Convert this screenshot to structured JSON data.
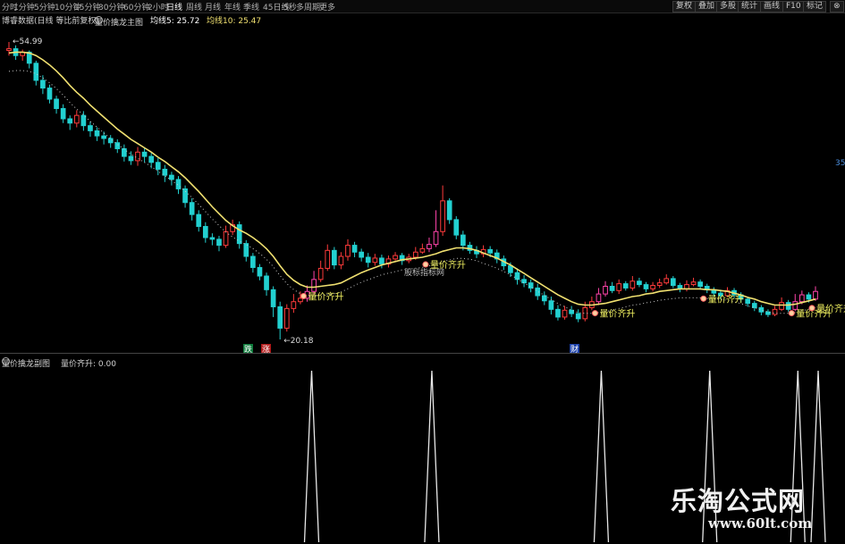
{
  "toolbar": {
    "periods": [
      "分时",
      "1分钟",
      "5分钟",
      "10分钟",
      "15分钟",
      "30分钟",
      "60分钟",
      "2小时",
      "日线",
      "周线",
      "月线",
      "年线",
      "季线",
      "45日线",
      "5秒",
      "多周期",
      "更多"
    ],
    "active_period": "日线",
    "right_buttons": [
      "复权",
      "叠加",
      "多股",
      "统计",
      "画线",
      "F10",
      "标记"
    ]
  },
  "header": {
    "source": "博睿数据(日线 等比前复权)",
    "main_indicator": "量价擒龙主图",
    "ma5": "均线5: 25.72",
    "ma10": "均线10: 25.47"
  },
  "sub_header": {
    "indicator": "量价擒龙副图",
    "value": "量价齐升: 0.00"
  },
  "annotations": {
    "high_price": "54.99",
    "low_price": "20.18",
    "center_watermark": "股标指标网",
    "signal_label": "量价齐升",
    "label_die": "跌",
    "label_zhang": "涨",
    "label_cai": "财",
    "right_edge": "35"
  },
  "watermark": {
    "title": "乐淘公式网",
    "url": "www.60lt.com"
  },
  "colors": {
    "up": "#ff3b3b",
    "down": "#22d0d0",
    "up_strong": "#ff44aa",
    "ma": "#f0e070",
    "dotted": "#cccccc",
    "signal_text": "#f0f060",
    "sub_line": "#e8e8e8"
  },
  "chart_data": {
    "type": "candlestick",
    "ylim": [
      20.18,
      54.99
    ],
    "candles": [
      [
        54.0,
        54.2,
        54.99,
        53.4
      ],
      [
        54.2,
        53.4,
        54.6,
        52.9
      ],
      [
        53.4,
        53.8,
        54.1,
        52.8
      ],
      [
        53.8,
        52.5,
        54.0,
        51.9
      ],
      [
        52.5,
        50.5,
        52.8,
        49.9
      ],
      [
        50.5,
        49.6,
        51.1,
        48.9
      ],
      [
        49.6,
        48.3,
        50.0,
        47.8
      ],
      [
        48.3,
        47.2,
        48.7,
        46.6
      ],
      [
        47.2,
        46.0,
        47.7,
        45.5
      ],
      [
        46.0,
        45.5,
        46.4,
        44.7
      ],
      [
        45.5,
        46.4,
        47.0,
        45.0
      ],
      [
        46.4,
        45.2,
        46.9,
        44.6
      ],
      [
        45.2,
        44.6,
        45.7,
        43.9
      ],
      [
        44.6,
        44.0,
        45.0,
        43.4
      ],
      [
        44.0,
        43.7,
        44.5,
        43.0
      ],
      [
        43.7,
        43.2,
        44.1,
        42.6
      ],
      [
        43.2,
        42.5,
        43.6,
        42.0
      ],
      [
        42.5,
        41.6,
        43.0,
        41.0
      ],
      [
        41.6,
        41.1,
        42.2,
        40.6
      ],
      [
        41.1,
        42.1,
        42.7,
        40.5
      ],
      [
        42.1,
        41.6,
        42.6,
        40.9
      ],
      [
        41.6,
        40.9,
        42.0,
        40.2
      ],
      [
        40.9,
        40.1,
        41.4,
        39.4
      ],
      [
        40.1,
        39.4,
        40.6,
        38.6
      ],
      [
        39.4,
        38.9,
        39.8,
        38.2
      ],
      [
        38.9,
        37.8,
        39.3,
        37.2
      ],
      [
        37.8,
        36.2,
        38.2,
        35.6
      ],
      [
        36.2,
        34.8,
        36.7,
        34.1
      ],
      [
        34.8,
        33.4,
        35.3,
        32.8
      ],
      [
        33.4,
        32.1,
        33.9,
        31.5
      ],
      [
        32.1,
        31.9,
        32.6,
        31.2
      ],
      [
        31.9,
        31.2,
        32.3,
        30.5
      ],
      [
        31.2,
        32.8,
        33.5,
        30.9
      ],
      [
        32.8,
        33.6,
        34.2,
        32.4
      ],
      [
        33.6,
        31.4,
        34.0,
        30.8
      ],
      [
        31.4,
        29.9,
        31.8,
        29.3
      ],
      [
        29.9,
        28.6,
        30.3,
        28.0
      ],
      [
        28.6,
        27.6,
        29.0,
        27.1
      ],
      [
        27.6,
        26.0,
        28.0,
        25.3
      ],
      [
        26.0,
        24.0,
        26.4,
        22.8
      ],
      [
        24.0,
        21.5,
        24.6,
        20.18
      ],
      [
        21.5,
        23.8,
        24.3,
        21.1
      ],
      [
        23.8,
        24.6,
        25.5,
        23.3
      ],
      [
        24.6,
        25.0,
        25.8,
        24.3
      ],
      [
        25.0,
        25.8,
        26.5,
        24.6
      ],
      [
        25.8,
        27.2,
        28.2,
        25.4
      ],
      [
        27.2,
        28.5,
        29.4,
        26.9
      ],
      [
        28.5,
        30.6,
        31.3,
        28.2
      ],
      [
        30.6,
        28.9,
        31.0,
        28.4
      ],
      [
        28.9,
        29.9,
        30.4,
        28.4
      ],
      [
        29.9,
        31.2,
        31.9,
        29.4
      ],
      [
        31.2,
        30.4,
        31.6,
        29.8
      ],
      [
        30.4,
        29.8,
        30.8,
        29.3
      ],
      [
        29.8,
        29.2,
        30.3,
        28.6
      ],
      [
        29.2,
        29.7,
        30.2,
        28.8
      ],
      [
        29.7,
        29.0,
        30.1,
        28.5
      ],
      [
        29.0,
        29.6,
        30.0,
        28.6
      ],
      [
        29.6,
        30.0,
        30.4,
        29.4
      ],
      [
        30.0,
        29.4,
        30.3,
        28.9
      ],
      [
        29.4,
        29.8,
        30.2,
        29.1
      ],
      [
        29.8,
        30.4,
        31.0,
        29.5
      ],
      [
        30.4,
        30.8,
        31.4,
        30.2
      ],
      [
        30.8,
        31.3,
        32.1,
        30.4
      ],
      [
        31.3,
        32.8,
        35.3,
        31.0
      ],
      [
        32.8,
        36.4,
        38.2,
        32.3
      ],
      [
        36.4,
        34.2,
        36.7,
        33.7
      ],
      [
        34.2,
        32.4,
        34.6,
        31.9
      ],
      [
        32.4,
        31.2,
        32.9,
        30.6
      ],
      [
        31.2,
        30.6,
        31.6,
        30.2
      ],
      [
        30.6,
        30.2,
        31.1,
        29.7
      ],
      [
        30.2,
        30.7,
        31.2,
        29.8
      ],
      [
        30.7,
        30.3,
        31.1,
        29.8
      ],
      [
        30.3,
        29.6,
        30.7,
        29.1
      ],
      [
        29.6,
        28.8,
        30.0,
        28.3
      ],
      [
        28.8,
        28.0,
        29.2,
        27.5
      ],
      [
        28.0,
        27.2,
        28.5,
        26.6
      ],
      [
        27.2,
        26.8,
        27.7,
        26.3
      ],
      [
        26.8,
        26.2,
        27.2,
        25.7
      ],
      [
        26.2,
        25.3,
        26.7,
        24.8
      ],
      [
        25.3,
        24.7,
        25.8,
        24.2
      ],
      [
        24.7,
        23.7,
        25.2,
        23.1
      ],
      [
        23.7,
        22.8,
        24.2,
        22.4
      ],
      [
        22.8,
        23.6,
        24.1,
        22.5
      ],
      [
        23.6,
        23.2,
        24.1,
        22.8
      ],
      [
        23.2,
        22.6,
        23.7,
        22.2
      ],
      [
        22.6,
        23.9,
        24.6,
        22.3
      ],
      [
        23.9,
        24.6,
        25.2,
        23.6
      ],
      [
        24.6,
        25.5,
        26.2,
        24.2
      ],
      [
        25.5,
        26.4,
        27.0,
        25.2
      ],
      [
        26.4,
        25.9,
        26.9,
        25.6
      ],
      [
        25.9,
        26.7,
        27.2,
        25.5
      ],
      [
        26.7,
        26.2,
        27.0,
        25.9
      ],
      [
        26.2,
        27.0,
        27.6,
        25.9
      ],
      [
        27.0,
        26.6,
        27.4,
        26.3
      ],
      [
        26.6,
        26.1,
        26.9,
        25.7
      ],
      [
        26.1,
        26.5,
        26.9,
        25.8
      ],
      [
        26.5,
        26.8,
        27.3,
        26.2
      ],
      [
        26.8,
        27.3,
        27.8,
        26.6
      ],
      [
        27.3,
        26.5,
        27.6,
        26.2
      ],
      [
        26.5,
        26.1,
        26.8,
        25.7
      ],
      [
        26.1,
        26.6,
        27.1,
        25.8
      ],
      [
        26.6,
        26.9,
        27.4,
        26.4
      ],
      [
        26.9,
        26.4,
        27.2,
        26.0
      ],
      [
        26.4,
        26.0,
        26.7,
        25.6
      ],
      [
        26.0,
        25.6,
        26.3,
        25.2
      ],
      [
        25.6,
        25.3,
        26.0,
        24.9
      ],
      [
        25.3,
        25.9,
        26.3,
        25.1
      ],
      [
        25.9,
        25.4,
        26.2,
        25.0
      ],
      [
        25.4,
        24.9,
        25.7,
        24.5
      ],
      [
        24.9,
        24.4,
        25.2,
        24.0
      ],
      [
        24.4,
        23.9,
        24.7,
        23.5
      ],
      [
        23.9,
        23.4,
        24.2,
        23.0
      ],
      [
        23.4,
        23.1,
        23.7,
        22.8
      ],
      [
        23.1,
        23.7,
        24.1,
        22.9
      ],
      [
        23.7,
        24.5,
        25.1,
        23.5
      ],
      [
        24.5,
        23.7,
        24.8,
        23.4
      ],
      [
        23.7,
        24.6,
        25.5,
        23.5
      ],
      [
        24.6,
        25.4,
        25.9,
        24.3
      ],
      [
        25.4,
        24.9,
        25.7,
        24.5
      ],
      [
        24.9,
        25.8,
        26.4,
        24.7
      ]
    ],
    "ma_line": [
      53.7,
      53.8,
      53.8,
      53.7,
      53.4,
      52.9,
      52.3,
      51.6,
      50.8,
      49.9,
      49.1,
      48.4,
      47.6,
      46.9,
      46.2,
      45.5,
      44.8,
      44.2,
      43.6,
      43.1,
      42.6,
      42.1,
      41.5,
      41.0,
      40.4,
      39.8,
      39.1,
      38.3,
      37.5,
      36.6,
      35.7,
      34.9,
      34.1,
      33.5,
      33.0,
      32.6,
      32.1,
      31.5,
      30.8,
      29.9,
      28.8,
      27.8,
      27.1,
      26.6,
      26.3,
      26.3,
      26.4,
      26.5,
      26.6,
      26.8,
      27.2,
      27.6,
      28.0,
      28.3,
      28.6,
      28.9,
      29.1,
      29.3,
      29.5,
      29.6,
      29.7,
      29.8,
      30.0,
      30.2,
      30.5,
      30.7,
      30.9,
      30.9,
      30.8,
      30.6,
      30.3,
      30.0,
      29.7,
      29.3,
      28.9,
      28.4,
      27.9,
      27.4,
      26.9,
      26.4,
      25.9,
      25.4,
      25.0,
      24.6,
      24.3,
      24.2,
      24.2,
      24.3,
      24.4,
      24.6,
      24.8,
      25.0,
      25.2,
      25.3,
      25.5,
      25.6,
      25.8,
      25.9,
      26.0,
      26.1,
      26.1,
      26.1,
      26.1,
      26.0,
      26.0,
      25.9,
      25.8,
      25.6,
      25.4,
      25.1,
      24.9,
      24.6,
      24.4,
      24.2,
      24.2,
      24.2,
      24.3,
      24.5,
      24.7,
      24.9
    ],
    "signal_days": [
      44,
      62,
      87,
      103,
      116,
      119
    ],
    "signal_text_days": [
      44,
      62,
      87,
      103,
      116,
      119
    ],
    "sub_chart": {
      "series": "量价齐升",
      "ylim": [
        0,
        1
      ]
    }
  }
}
